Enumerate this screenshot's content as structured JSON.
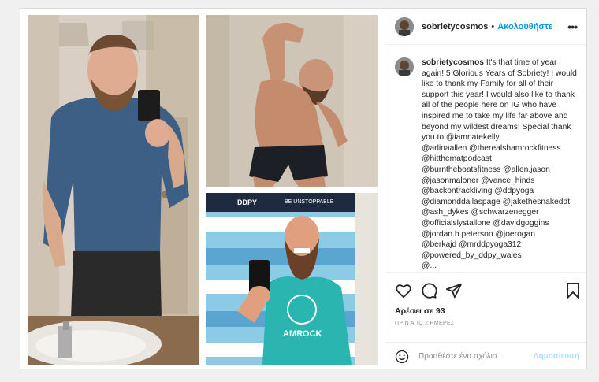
{
  "post": {
    "username": "sobrietycosmos",
    "separator": "•",
    "follow_label": "Ακολουθήστε",
    "more_icon": "more-horizontal-icon",
    "avatar_icon": "profile-avatar"
  },
  "caption": {
    "username": "sobrietycosmos",
    "text": "It's that time of year again! 5 Glorious Years of Sobriety! I would like to thank my Family for all of their support this year! I would also like to thank all of the people here on IG who have inspired me to take my life far above and beyond my wildest dreams! Special thank you to @iamnatekelly",
    "mentions": [
      "@arlinaallen @therealshamrockfitness",
      "@hitthematpodcast",
      "@burntheboatsfitness @allen.jason",
      "@jasonmaloner @vance_hinds",
      "@backontrackliving @ddpyoga",
      "@diamonddallaspage @jakethesnakeddt",
      "@ash_dykes @schwarzenegger",
      "@officialslystallone @davidgoggins",
      "@jordan.b.peterson @joerogan",
      "@berkajd @mrddpyoga312",
      "@powered_by_ddpy_wales",
      "@..."
    ]
  },
  "actions": {
    "like_icon": "heart-icon",
    "comment_icon": "comment-icon",
    "share_icon": "paper-plane-icon",
    "save_icon": "bookmark-icon"
  },
  "likes_text": "Αρέσει σε 93",
  "timestamp_text": "ΠΡΙΝ ΑΠΟ 2 ΗΜΕΡΕΣ",
  "comment": {
    "placeholder": "Προσθέστε ένα σχόλιο...",
    "post_label": "Δημοσίευση",
    "emoji_icon": "emoji-smile-icon"
  },
  "photos": {
    "top_banner_text_1": "DDPY",
    "top_banner_text_2": "BE UNSTOPPABLE",
    "shirt_text": "AMROCK"
  },
  "colors": {
    "link_blue": "#0095f6",
    "disabled_blue": "#b2dffc",
    "text": "#262626",
    "muted": "#8e8e8e",
    "border": "#dbdbdb"
  }
}
